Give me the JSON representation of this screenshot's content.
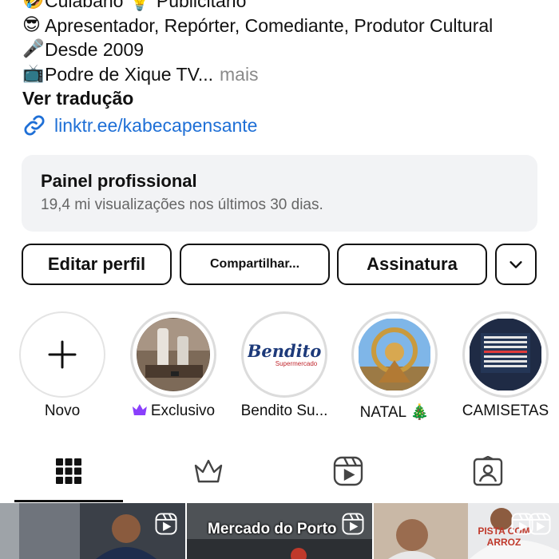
{
  "bio": {
    "lines": [
      {
        "emoji": "🤣",
        "text": "Cuiabano 💡 Publicitário"
      },
      {
        "emoji": "😎",
        "text": "Apresentador, Repórter, Comediante, Produtor Cultural"
      },
      {
        "emoji": "🎤",
        "text": "Desde 2009"
      },
      {
        "emoji": "📺",
        "text": "Podre de Xique TV..."
      }
    ],
    "more_label": "mais",
    "translate_label": "Ver tradução",
    "link_text": "linktr.ee/kabecapensante"
  },
  "dashboard": {
    "title": "Painel profissional",
    "subtitle": "19,4 mi visualizações nos últimos 30 dias."
  },
  "buttons": {
    "edit": "Editar perfil",
    "share": "Compartilhar...",
    "subscription": "Assinatura"
  },
  "highlights": [
    {
      "label": "Novo"
    },
    {
      "label": "Exclusivo",
      "icon": "crown-icon",
      "icon_color": "#8a3ffc"
    },
    {
      "label": "Bendito Su...",
      "logo_text": "Bendito",
      "logo_sub": "Supermercado"
    },
    {
      "label": "NATAL 🎄"
    },
    {
      "label": "CAMISETAS"
    }
  ],
  "tabs": [
    {
      "name": "grid-icon",
      "active": true
    },
    {
      "name": "crown-icon",
      "active": false
    },
    {
      "name": "reels-icon",
      "active": false
    },
    {
      "name": "tagged-icon",
      "active": false
    }
  ],
  "posts": [
    {
      "caption": ""
    },
    {
      "caption": "Mercado do Porto"
    },
    {
      "caption": ""
    },
    {
      "caption": "PISTA COM ARROZ"
    }
  ],
  "colors": {
    "link": "#1e6fd6",
    "panel_bg": "#f2f3f5",
    "exclusive_crown": "#8a3ffc"
  }
}
